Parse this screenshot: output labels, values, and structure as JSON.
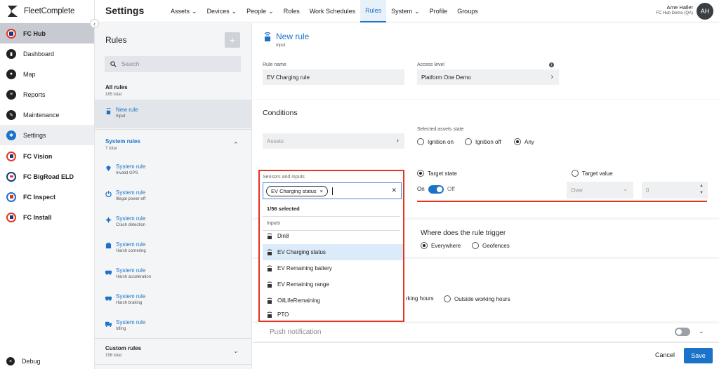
{
  "brand": {
    "name": "FleetComplete"
  },
  "sidebar": {
    "items": [
      {
        "label": "FC Hub"
      },
      {
        "label": "Dashboard"
      },
      {
        "label": "Map"
      },
      {
        "label": "Reports"
      },
      {
        "label": "Maintenance"
      },
      {
        "label": "Settings"
      },
      {
        "label": "FC Vision"
      },
      {
        "label": "FC BigRoad ELD"
      },
      {
        "label": "FC Inspect"
      },
      {
        "label": "FC Install"
      }
    ],
    "debug_label": "Debug"
  },
  "header": {
    "title": "Settings",
    "tabs": [
      {
        "label": "Assets",
        "dropdown": true
      },
      {
        "label": "Devices",
        "dropdown": true
      },
      {
        "label": "People",
        "dropdown": true
      },
      {
        "label": "Roles"
      },
      {
        "label": "Work Schedules"
      },
      {
        "label": "Rules",
        "active": true
      },
      {
        "label": "System",
        "dropdown": true
      },
      {
        "label": "Profile"
      },
      {
        "label": "Groups"
      }
    ],
    "user_name": "Arne Haller",
    "user_org": "FC Hub Demo (QA)",
    "avatar_initials": "AH"
  },
  "rules_panel": {
    "title": "Rules",
    "search_placeholder": "Search",
    "all_rules": {
      "title": "All rules",
      "count": "165 total"
    },
    "new_rule": {
      "title": "New rule",
      "sub": "Input"
    },
    "system_rules": {
      "title": "System rules",
      "count": "7 total"
    },
    "system_items": [
      {
        "title": "System rule",
        "sub": "Invalid GPS",
        "icon": "location-pin-icon"
      },
      {
        "title": "System rule",
        "sub": "Illegal power-off",
        "icon": "power-off-icon"
      },
      {
        "title": "System rule",
        "sub": "Crash detection",
        "icon": "crash-icon"
      },
      {
        "title": "System rule",
        "sub": "Harsh cornering",
        "icon": "cornering-icon"
      },
      {
        "title": "System rule",
        "sub": "Harsh acceleration",
        "icon": "acceleration-icon"
      },
      {
        "title": "System rule",
        "sub": "Harsh braking",
        "icon": "braking-icon"
      },
      {
        "title": "System rule",
        "sub": "Idling",
        "icon": "truck-icon"
      }
    ],
    "custom_rules": {
      "title": "Custom rules",
      "count": "158 total"
    }
  },
  "editor": {
    "title": "New rule",
    "subtitle": "Input",
    "rule_name_label": "Rule name",
    "rule_name_value": "EV Charging rule",
    "access_level_label": "Access level",
    "access_level_value": "Platform One Demo",
    "conditions_title": "Conditions",
    "assets_placeholder": "Assets",
    "selected_assets_state_label": "Selected assets state",
    "ignition_options": [
      {
        "label": "Ignition on",
        "checked": false
      },
      {
        "label": "Ignition off",
        "checked": false
      },
      {
        "label": "Any",
        "checked": true
      }
    ],
    "target_state_label": "Target state",
    "target_value_label": "Target value",
    "toggle_on_label": "On",
    "toggle_off_label": "Off",
    "toggle_state": "on",
    "operator_placeholder": "Over",
    "value_placeholder": "0",
    "trigger_title": "Where does the rule trigger",
    "trigger_options": [
      {
        "label": "Everywhere",
        "checked": true
      },
      {
        "label": "Geofences",
        "checked": false
      }
    ],
    "hours_fragment": "rking hours",
    "outside_hours_label": "Outside working hours",
    "push_notification_label": "Push notification"
  },
  "dropdown": {
    "label": "Sensors and inputs",
    "chip": "EV Charging status",
    "selected_count": "1/56 selected",
    "group_header": "Inputs",
    "options": [
      {
        "label": "Din8",
        "highlighted": false
      },
      {
        "label": "EV Charging status",
        "highlighted": true
      },
      {
        "label": "EV Remaining battery",
        "highlighted": false
      },
      {
        "label": "EV Remaining range",
        "highlighted": false
      },
      {
        "label": "OilLifeRemaining",
        "highlighted": false
      },
      {
        "label": "PTO",
        "highlighted": false
      }
    ]
  },
  "footer": {
    "cancel_label": "Cancel",
    "save_label": "Save"
  },
  "colors": {
    "accent": "#1a73c9",
    "highlight": "#e53322",
    "nav_selected": "#c7cbd1"
  }
}
